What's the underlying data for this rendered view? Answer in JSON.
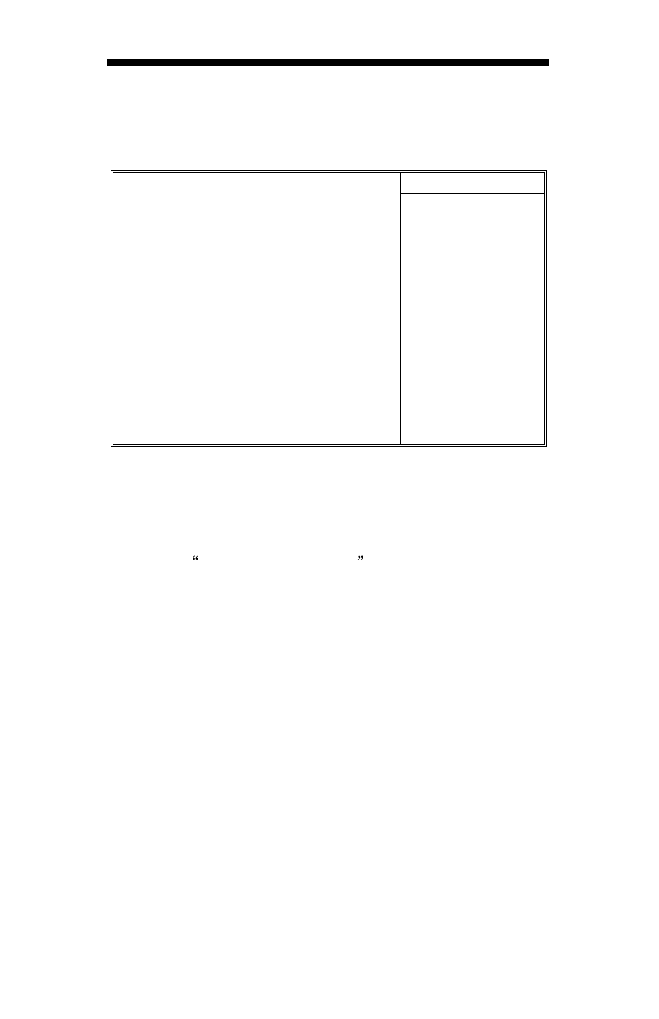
{
  "quotes": {
    "left": "“",
    "right": "”"
  }
}
